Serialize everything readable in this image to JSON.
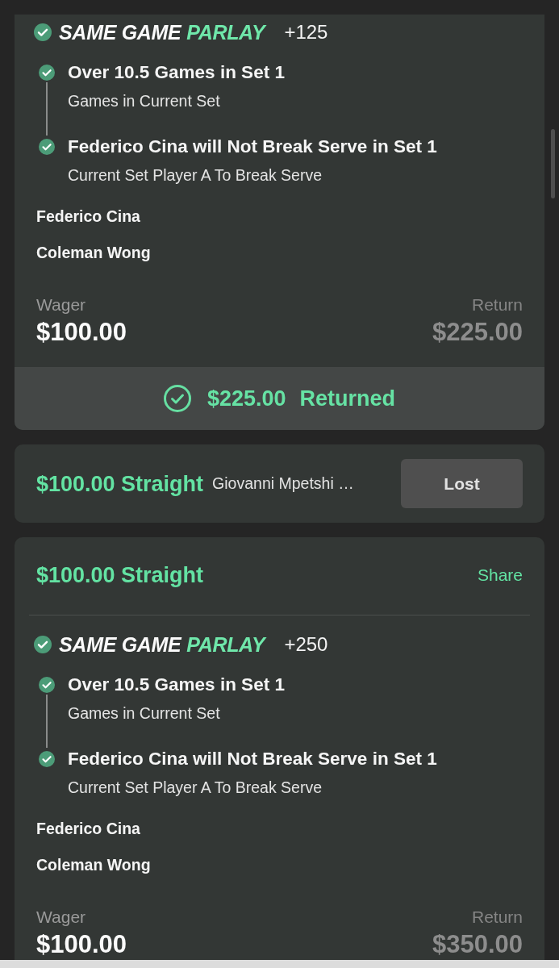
{
  "bets": [
    {
      "kind": "expanded",
      "parlay": {
        "won": true,
        "title": "SAME GAME",
        "title_accent": "PARLAY",
        "odds": "+125",
        "legs": [
          {
            "title": "Over 10.5 Games in Set 1",
            "market": "Games in Current Set",
            "won": true
          },
          {
            "title": "Federico Cina will Not Break Serve in Set 1",
            "market": "Current Set Player A To Break Serve",
            "won": true
          }
        ],
        "players": [
          "Federico Cina",
          "Coleman Wong"
        ]
      },
      "wager_label": "Wager",
      "wager": "$100.00",
      "return_label": "Return",
      "return": "$225.00",
      "result": {
        "kind": "returned",
        "amount": "$225.00",
        "label": "Returned"
      }
    },
    {
      "kind": "collapsed",
      "title": "$100.00 Straight",
      "selection": "Giovanni Mpetshi …",
      "result": {
        "kind": "lost",
        "label": "Lost"
      }
    },
    {
      "kind": "expanded",
      "title": "$100.00 Straight",
      "share": "Share",
      "parlay": {
        "won": true,
        "title": "SAME GAME",
        "title_accent": "PARLAY",
        "odds": "+250",
        "legs": [
          {
            "title": "Over 10.5 Games in Set 1",
            "market": "Games in Current Set",
            "won": true
          },
          {
            "title": "Federico Cina will Not Break Serve in Set 1",
            "market": "Current Set Player A To Break Serve",
            "won": true
          }
        ],
        "players": [
          "Federico Cina",
          "Coleman Wong"
        ]
      },
      "wager_label": "Wager",
      "wager": "$100.00",
      "return_label": "Return",
      "return": "$350.00"
    }
  ]
}
